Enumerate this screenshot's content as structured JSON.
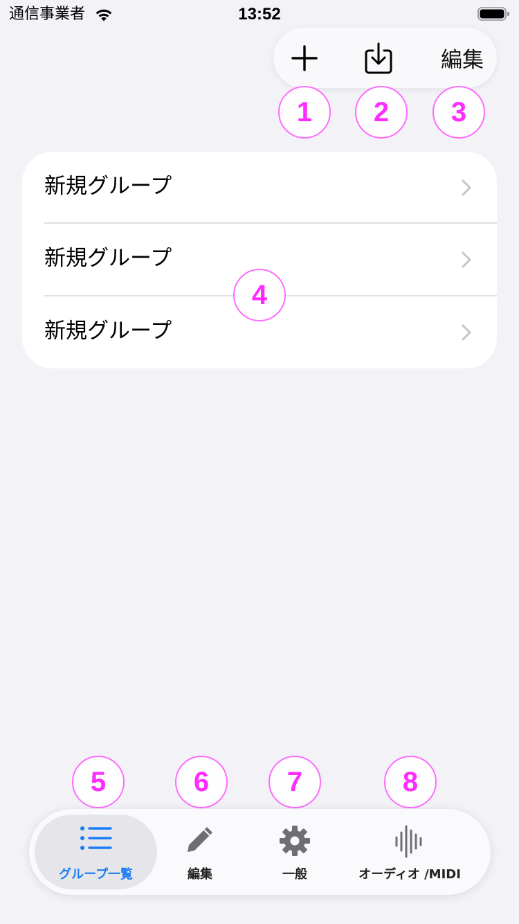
{
  "status_bar": {
    "carrier": "通信事業者",
    "time": "13:52"
  },
  "toolbar": {
    "add_icon": "plus-icon",
    "import_icon": "tray-arrow-down-icon",
    "edit_label": "編集"
  },
  "badges": [
    "1",
    "2",
    "3",
    "4",
    "5",
    "6",
    "7",
    "8"
  ],
  "groups": [
    {
      "label": "新規グループ"
    },
    {
      "label": "新規グループ"
    },
    {
      "label": "新規グループ"
    }
  ],
  "tabs": [
    {
      "label": "グループ一覧",
      "icon": "list-bullet-icon",
      "active": true
    },
    {
      "label": "編集",
      "icon": "pencil-icon",
      "active": false
    },
    {
      "label": "一般",
      "icon": "gear-icon",
      "active": false
    },
    {
      "label": "オーディオ /MIDI",
      "icon": "waveform-icon",
      "active": false
    }
  ],
  "colors": {
    "accent": "#1a7cf5",
    "badge": "#ff2bff",
    "background": "#f2f2f7"
  }
}
